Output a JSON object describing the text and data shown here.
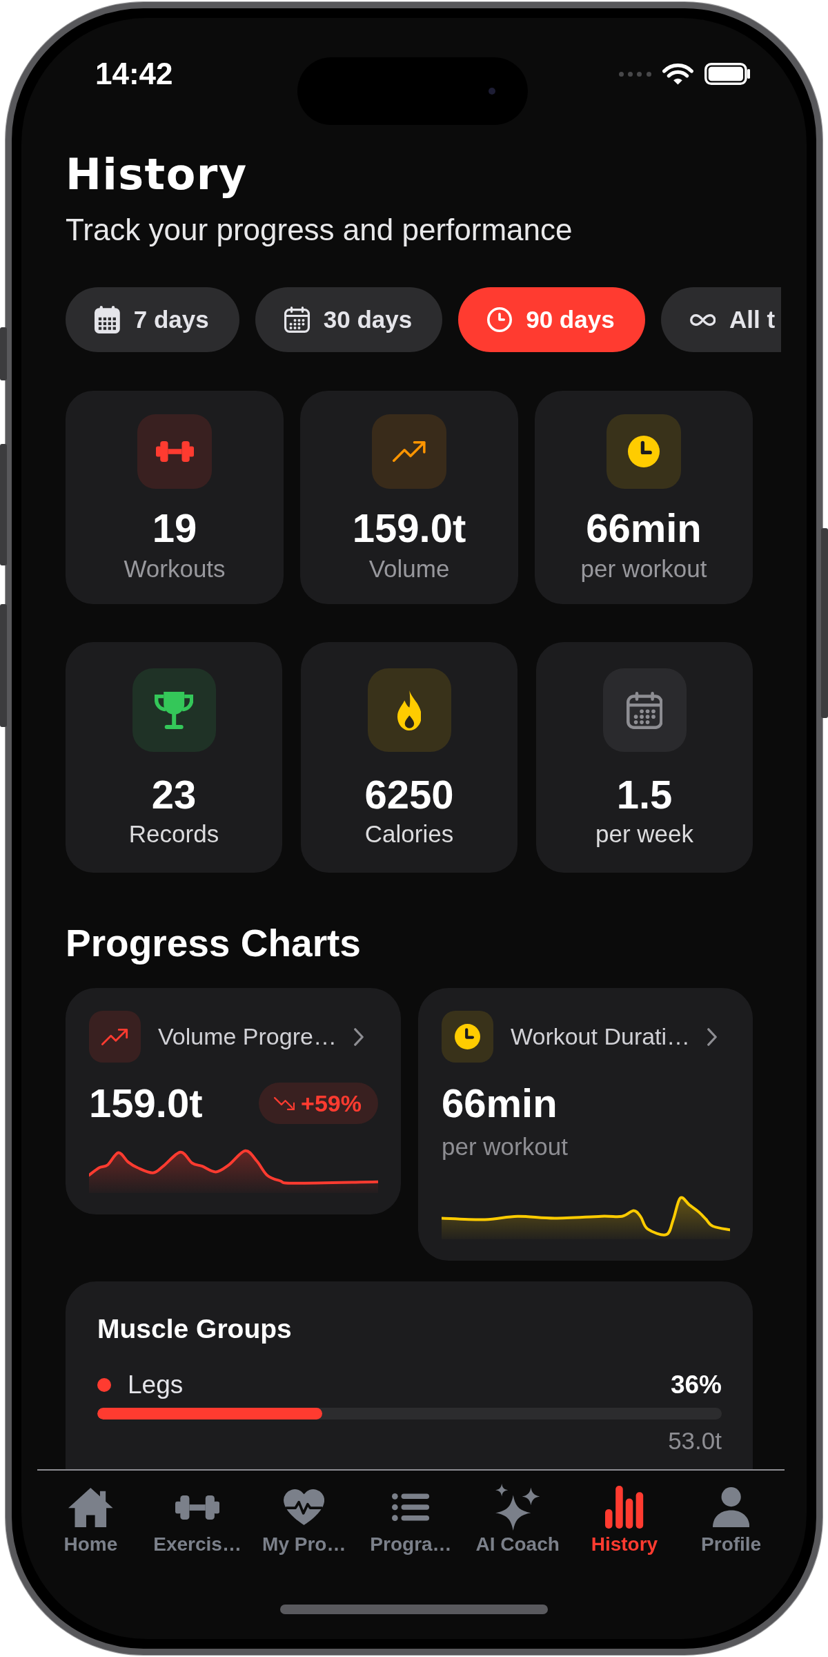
{
  "status_bar": {
    "time": "14:42"
  },
  "header": {
    "title": "History",
    "subtitle": "Track your progress and performance"
  },
  "periods": [
    {
      "label": "7 days",
      "selected": false
    },
    {
      "label": "30 days",
      "selected": false
    },
    {
      "label": "90 days",
      "selected": true
    },
    {
      "label": "All t",
      "selected": false
    }
  ],
  "summary_stats": [
    {
      "value": "19",
      "label": "Workouts",
      "color": "#ff3b30"
    },
    {
      "value": "159.0t",
      "label": "Volume",
      "color": "#ff9500"
    },
    {
      "value": "66min",
      "label": "per workout",
      "color": "#ffcc00"
    }
  ],
  "extra_stats": [
    {
      "value": "23",
      "label": "Records",
      "color": "#34c759"
    },
    {
      "value": "6250",
      "label": "Calories",
      "color": "#ffcc00"
    },
    {
      "value": "1.5",
      "label": "per week",
      "color": "#8e8e93"
    }
  ],
  "progress_charts": {
    "title": "Progress Charts",
    "cards": [
      {
        "title": "Volume Progre…",
        "value": "159.0t",
        "change": {
          "text": "+59%",
          "falling": true
        },
        "color": "#ff3b30"
      },
      {
        "title": "Workout Durati…",
        "value": "66min",
        "caption": "per workout",
        "color": "#ffcc00"
      }
    ]
  },
  "muscle_groups": {
    "title": "Muscle Groups",
    "items": [
      {
        "name": "Legs",
        "color": "#ff3b30",
        "share": "36%",
        "level": 0.36,
        "amount": "53.0t"
      }
    ]
  },
  "tab_bar": [
    {
      "label": "Home",
      "selected": false
    },
    {
      "label": "Exercis…",
      "selected": false
    },
    {
      "label": "My Pro…",
      "selected": false
    },
    {
      "label": "Progra…",
      "selected": false
    },
    {
      "label": "AI Coach",
      "selected": false
    },
    {
      "label": "History",
      "selected": true
    },
    {
      "label": "Profile",
      "selected": false
    }
  ]
}
